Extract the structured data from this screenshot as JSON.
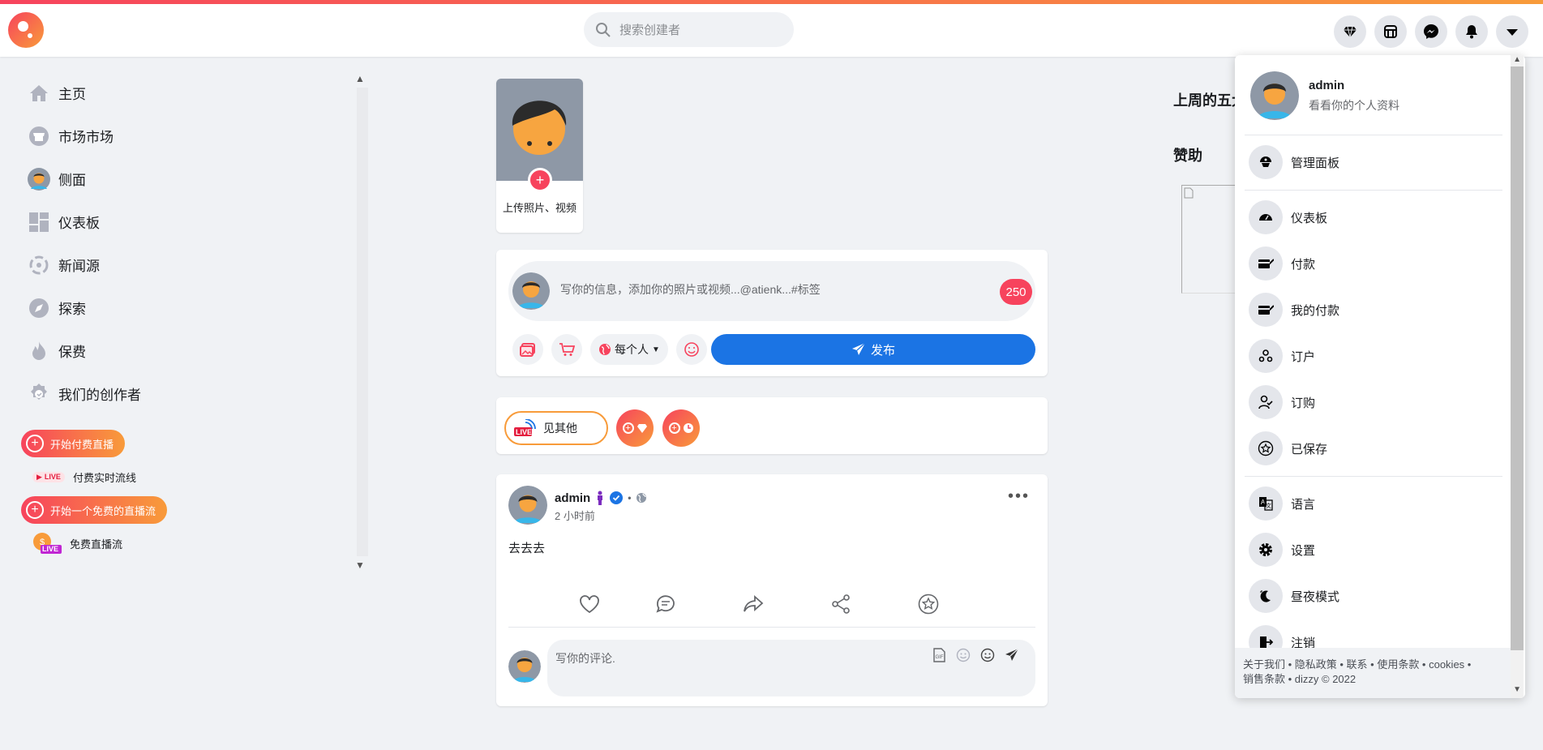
{
  "header": {
    "search_placeholder": "搜索创建者"
  },
  "sidebar": {
    "items": [
      {
        "label": "主页",
        "icon": "home-icon"
      },
      {
        "label": "市场市场",
        "icon": "store-icon"
      },
      {
        "label": "侧面",
        "icon": "avatar"
      },
      {
        "label": "仪表板",
        "icon": "dashboard-icon"
      },
      {
        "label": "新闻源",
        "icon": "feed-icon"
      },
      {
        "label": "探索",
        "icon": "compass-icon"
      },
      {
        "label": "保费",
        "icon": "fire-icon"
      },
      {
        "label": "我们的创作者",
        "icon": "creators-icon"
      }
    ],
    "paid_live_button": "开始付费直播",
    "paid_live_stream": "付费实时流线",
    "free_live_button": "开始一个免费的直播流",
    "free_live_stream": "免费直播流",
    "live_badge": "LIVE"
  },
  "story": {
    "upload_label": "上传照片、视频"
  },
  "composer": {
    "placeholder": "写你的信息，添加你的照片或视频...@atienk...#标签",
    "char_count": "250",
    "privacy": "每个人",
    "publish": "发布"
  },
  "live": {
    "see_others": "见其他",
    "live_badge": "LIVE"
  },
  "post": {
    "author": "admin",
    "time": "2 小时前",
    "body": "去去去",
    "comment_placeholder": "写你的评论."
  },
  "right": {
    "top_creators": "上周的五大",
    "sponsored": "赞助"
  },
  "dropdown": {
    "name": "admin",
    "profile_link": "看看你的个人资料",
    "items": [
      {
        "label": "管理面板",
        "icon": "admin-panel-icon"
      },
      {
        "label": "仪表板",
        "icon": "dashboard-gauge-icon"
      },
      {
        "label": "付款",
        "icon": "payments-icon"
      },
      {
        "label": "我的付款",
        "icon": "my-payments-icon"
      },
      {
        "label": "订户",
        "icon": "subscribers-icon"
      },
      {
        "label": "订购",
        "icon": "subscriptions-icon"
      },
      {
        "label": "已保存",
        "icon": "saved-star-icon"
      },
      {
        "label": "语言",
        "icon": "language-icon"
      },
      {
        "label": "设置",
        "icon": "settings-gear-icon"
      },
      {
        "label": "昼夜模式",
        "icon": "moon-icon"
      },
      {
        "label": "注销",
        "icon": "logout-icon"
      }
    ],
    "footer_line1": "关于我们 • 隐私政策 • 联系 • 使用条款 • cookies •",
    "footer_line2": "销售条款 • dizzy © 2022"
  },
  "colors": {
    "accent_red": "#f7435d",
    "accent_orange": "#f89b3a",
    "primary_blue": "#1b74e4"
  }
}
